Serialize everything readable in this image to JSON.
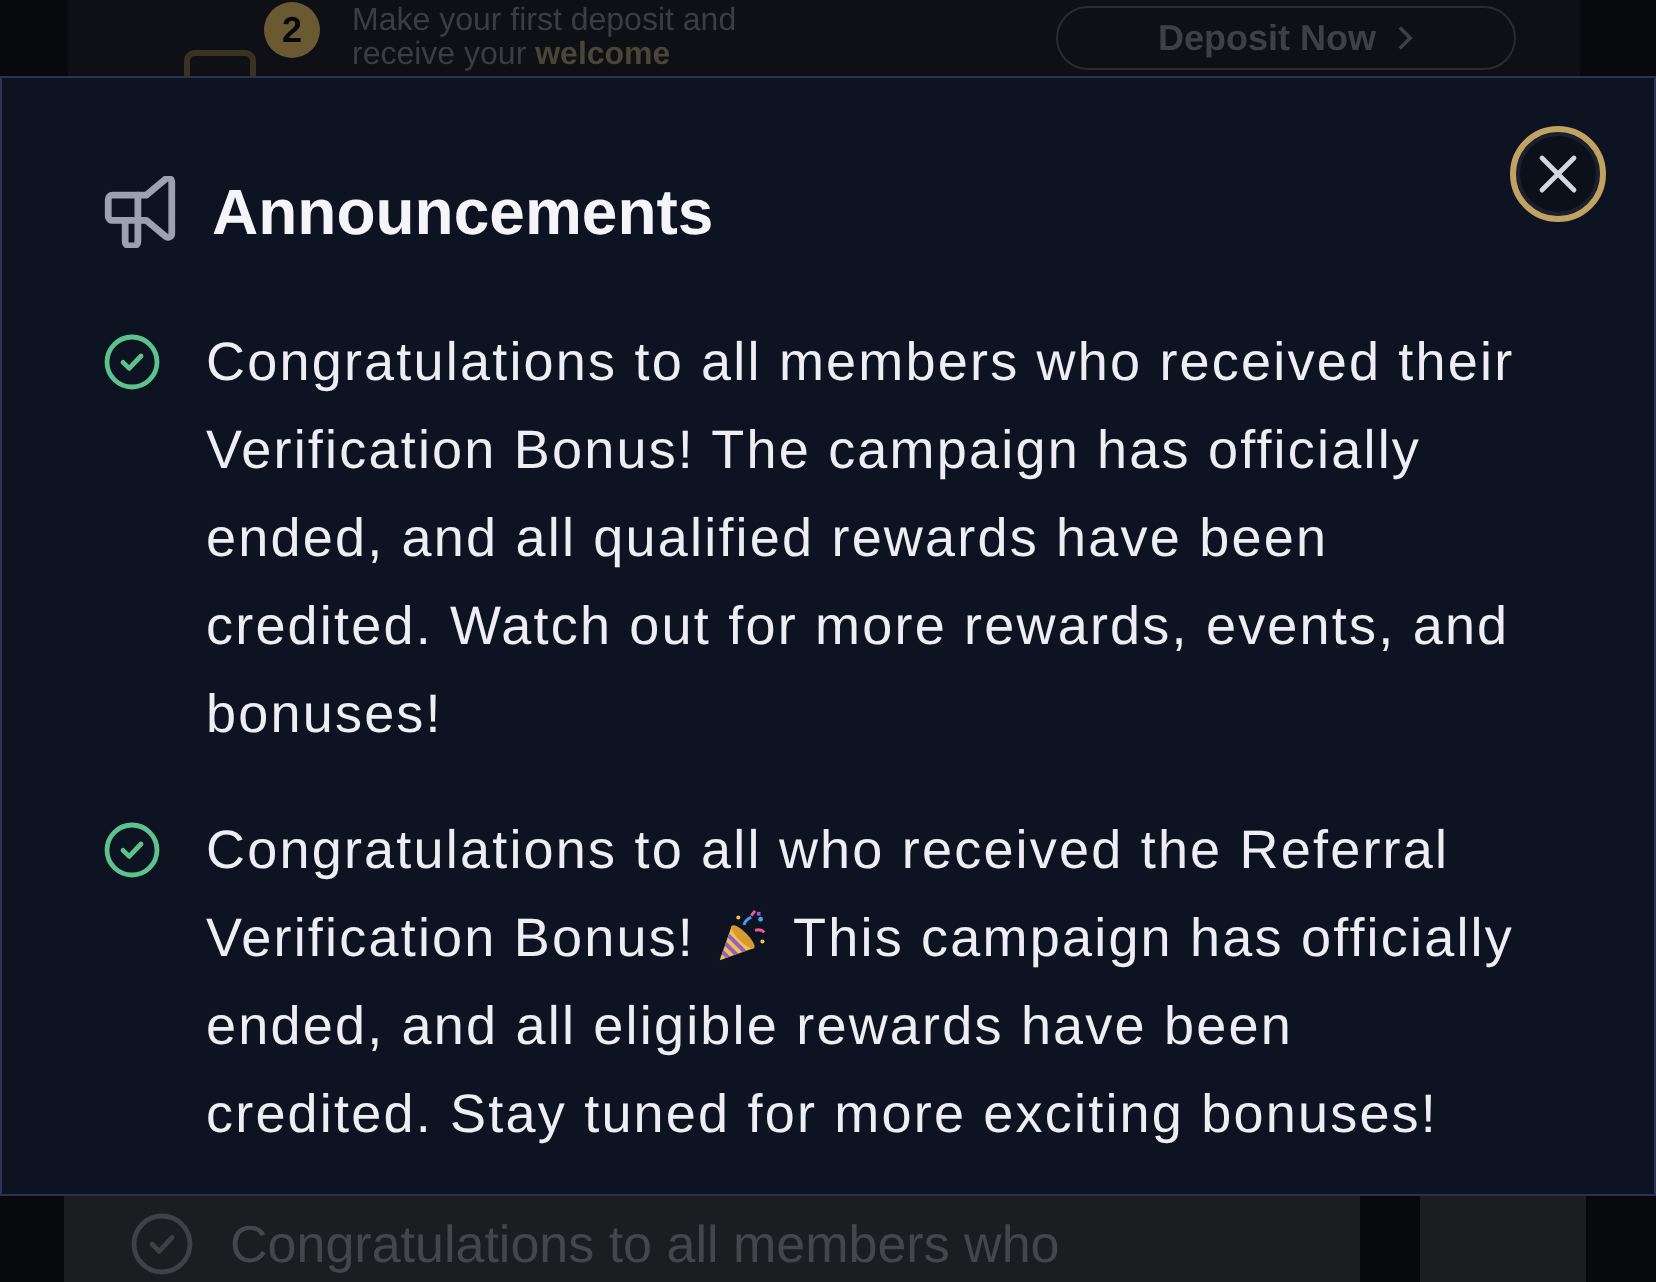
{
  "background_page": {
    "top_card": {
      "step_badge": "2",
      "promo_text": "Make your first deposit and receive your **welcome**",
      "deposit_button": "Deposit Now"
    },
    "bottom_card": {
      "text": "Congratulations to all members who"
    }
  },
  "dialog": {
    "title": "Announcements",
    "items": [
      {
        "segments": [
          {
            "kind": "text",
            "text": "Congratulations to all members who received their Verification Bonus! The campaign has officially ended, and all qualified rewards have been credited. Watch out for more rewards, events, and bonuses!"
          }
        ]
      },
      {
        "segments": [
          {
            "kind": "text",
            "text": "Congratulations to all who received the Referral Verification Bonus!"
          },
          {
            "kind": "emoji"
          },
          {
            "kind": "text",
            "text": "This campaign has officially ended, and all eligible rewards have been credited. Stay tuned for more exciting bonuses!"
          }
        ]
      }
    ]
  }
}
